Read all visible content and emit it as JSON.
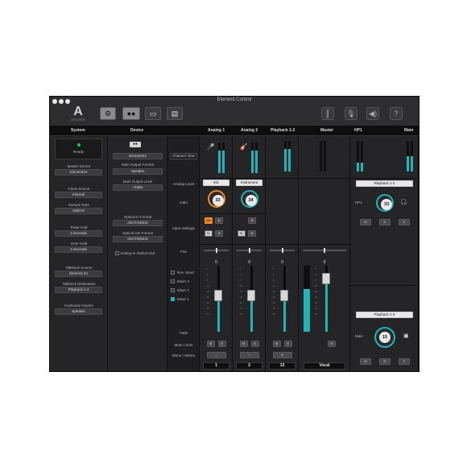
{
  "window": {
    "title": "Element Control"
  },
  "brand": {
    "logo_letter": "A",
    "logo_text": "APOGEE"
  },
  "toolbar": {
    "buttons": [
      "gear-icon",
      "tape-icon",
      "device-icon",
      "mixer-icon"
    ],
    "right": [
      "meter-icon",
      "mic-icon",
      "speaker-icon",
      "help-icon"
    ],
    "help_label": "?"
  },
  "headers": {
    "system": "System",
    "device": "Device",
    "analog1": "Analog 1",
    "analog2": "Analog 2",
    "playback": "Playback 1-2",
    "master": "Master",
    "hp1": "HP1",
    "main": "Main"
  },
  "system": {
    "status": "Ready",
    "master_device_label": "Master Device",
    "master_device": "Element24",
    "clock_source_label": "Clock Source",
    "clock_source": "Internal",
    "sample_rate_label": "Sample Rate",
    "sample_rate": "192kHz",
    "peak_hold_label": "Peak Hold",
    "peak_hold": "2 seconds",
    "over_hold_label": "Over Hold",
    "over_hold": "2 seconds",
    "talkback_source_label": "Talkback Source",
    "talkback_source": "Element 24",
    "talkback_dest_label": "Talkback Destination",
    "talkback_dest": "Playback 1-2",
    "keyboard_volume_label": "Keyboard Volume",
    "keyboard_volume": "Speaker"
  },
  "device": {
    "name": "Element24",
    "main_output_format_label": "Main Output Format",
    "main_output_format": "Speaker",
    "main_output_level_label": "Main Output Level",
    "main_output_level": "+4dBu",
    "optical_in_label": "Optical In Format",
    "optical_in": "ADAT/SMUX",
    "optical_out_label": "Optical Out Format",
    "optical_out": "ADAT/SMUX",
    "analog_opt_out": "Analog-In-Optical Out"
  },
  "row_labels": {
    "channel_view": "Channel View",
    "analog_level": "Analog Level",
    "gain": "Gain",
    "input_settings": "Input Settings",
    "pan": "Pan",
    "rev_send": "Rev. Send",
    "mixer3": "Mixer 3",
    "mixer2": "Mixer 2",
    "mixer1": "Mixer 1",
    "fade": "Fade",
    "mute_solo": "Mute | Solo",
    "mono_stereo": "Mono | Stereo"
  },
  "channels": [
    {
      "level": "Mic",
      "gain": "33",
      "pan": "0",
      "number": "1",
      "meter": 0.55,
      "fader": 0.55,
      "btn1": "48V",
      "btn2": "Ø",
      "btn3": "SL",
      "btn4": "Ø"
    },
    {
      "level": "Instrument",
      "gain": "34",
      "pan": "0",
      "number": "2",
      "meter": 0.55,
      "fader": 0.55,
      "btn1": "Ø",
      "btn2": "Ø",
      "btn3": "SL",
      "btn4": "Ø"
    },
    {
      "pan": "0",
      "number": "13",
      "meter": 0.55,
      "fader": 0.55
    }
  ],
  "master": {
    "pan": "0",
    "name": "Vocal",
    "meter": 0.65,
    "fader": 0.8
  },
  "mute_label": "M",
  "solo_label": "S",
  "hp1": {
    "source": "Playback 1-2",
    "label": "HP1",
    "knob": "33",
    "buttons": [
      "M",
      "D",
      "Σ"
    ]
  },
  "main": {
    "source": "Playback 1-2",
    "label": "Main",
    "knob": "15",
    "buttons": [
      "M",
      "D",
      "Σ"
    ]
  },
  "scale": [
    "0",
    "3",
    "6",
    "10",
    "15",
    "20",
    "30",
    "40",
    "60"
  ],
  "colors": {
    "accent": "#1fb5b8",
    "orange": "#f08a24",
    "green": "#22c55e"
  }
}
